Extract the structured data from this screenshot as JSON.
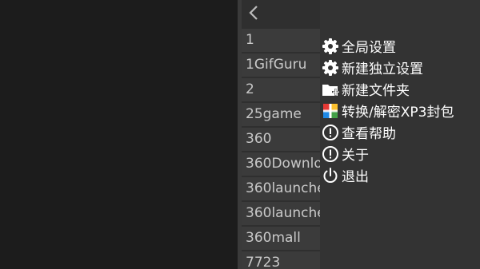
{
  "nav": {
    "back_icon": "chevron-left-icon"
  },
  "files": [
    "1",
    "1GifGuru",
    "2",
    "25game",
    "360",
    "360Downlo",
    "360launche",
    "360launche",
    "360mall",
    "7723"
  ],
  "menu": [
    {
      "label": "全局设置",
      "icon": "gear-icon"
    },
    {
      "label": "新建独立设置",
      "icon": "gear-icon"
    },
    {
      "label": "新建文件夹",
      "icon": "folder-add-icon"
    },
    {
      "label": "转换/解密XP3封包",
      "icon": "package-icon"
    },
    {
      "label": "查看帮助",
      "icon": "info-circle-icon"
    },
    {
      "label": "关于",
      "icon": "info-circle-icon"
    },
    {
      "label": "退出",
      "icon": "power-icon"
    }
  ],
  "colors": {
    "background": "#1c1c1c",
    "file_pane": "#2f2f2f",
    "file_item": "#3b3b3b",
    "menu_panel": "#333333",
    "menu_text": "#ffffff",
    "file_text": "#c9c9c9"
  }
}
